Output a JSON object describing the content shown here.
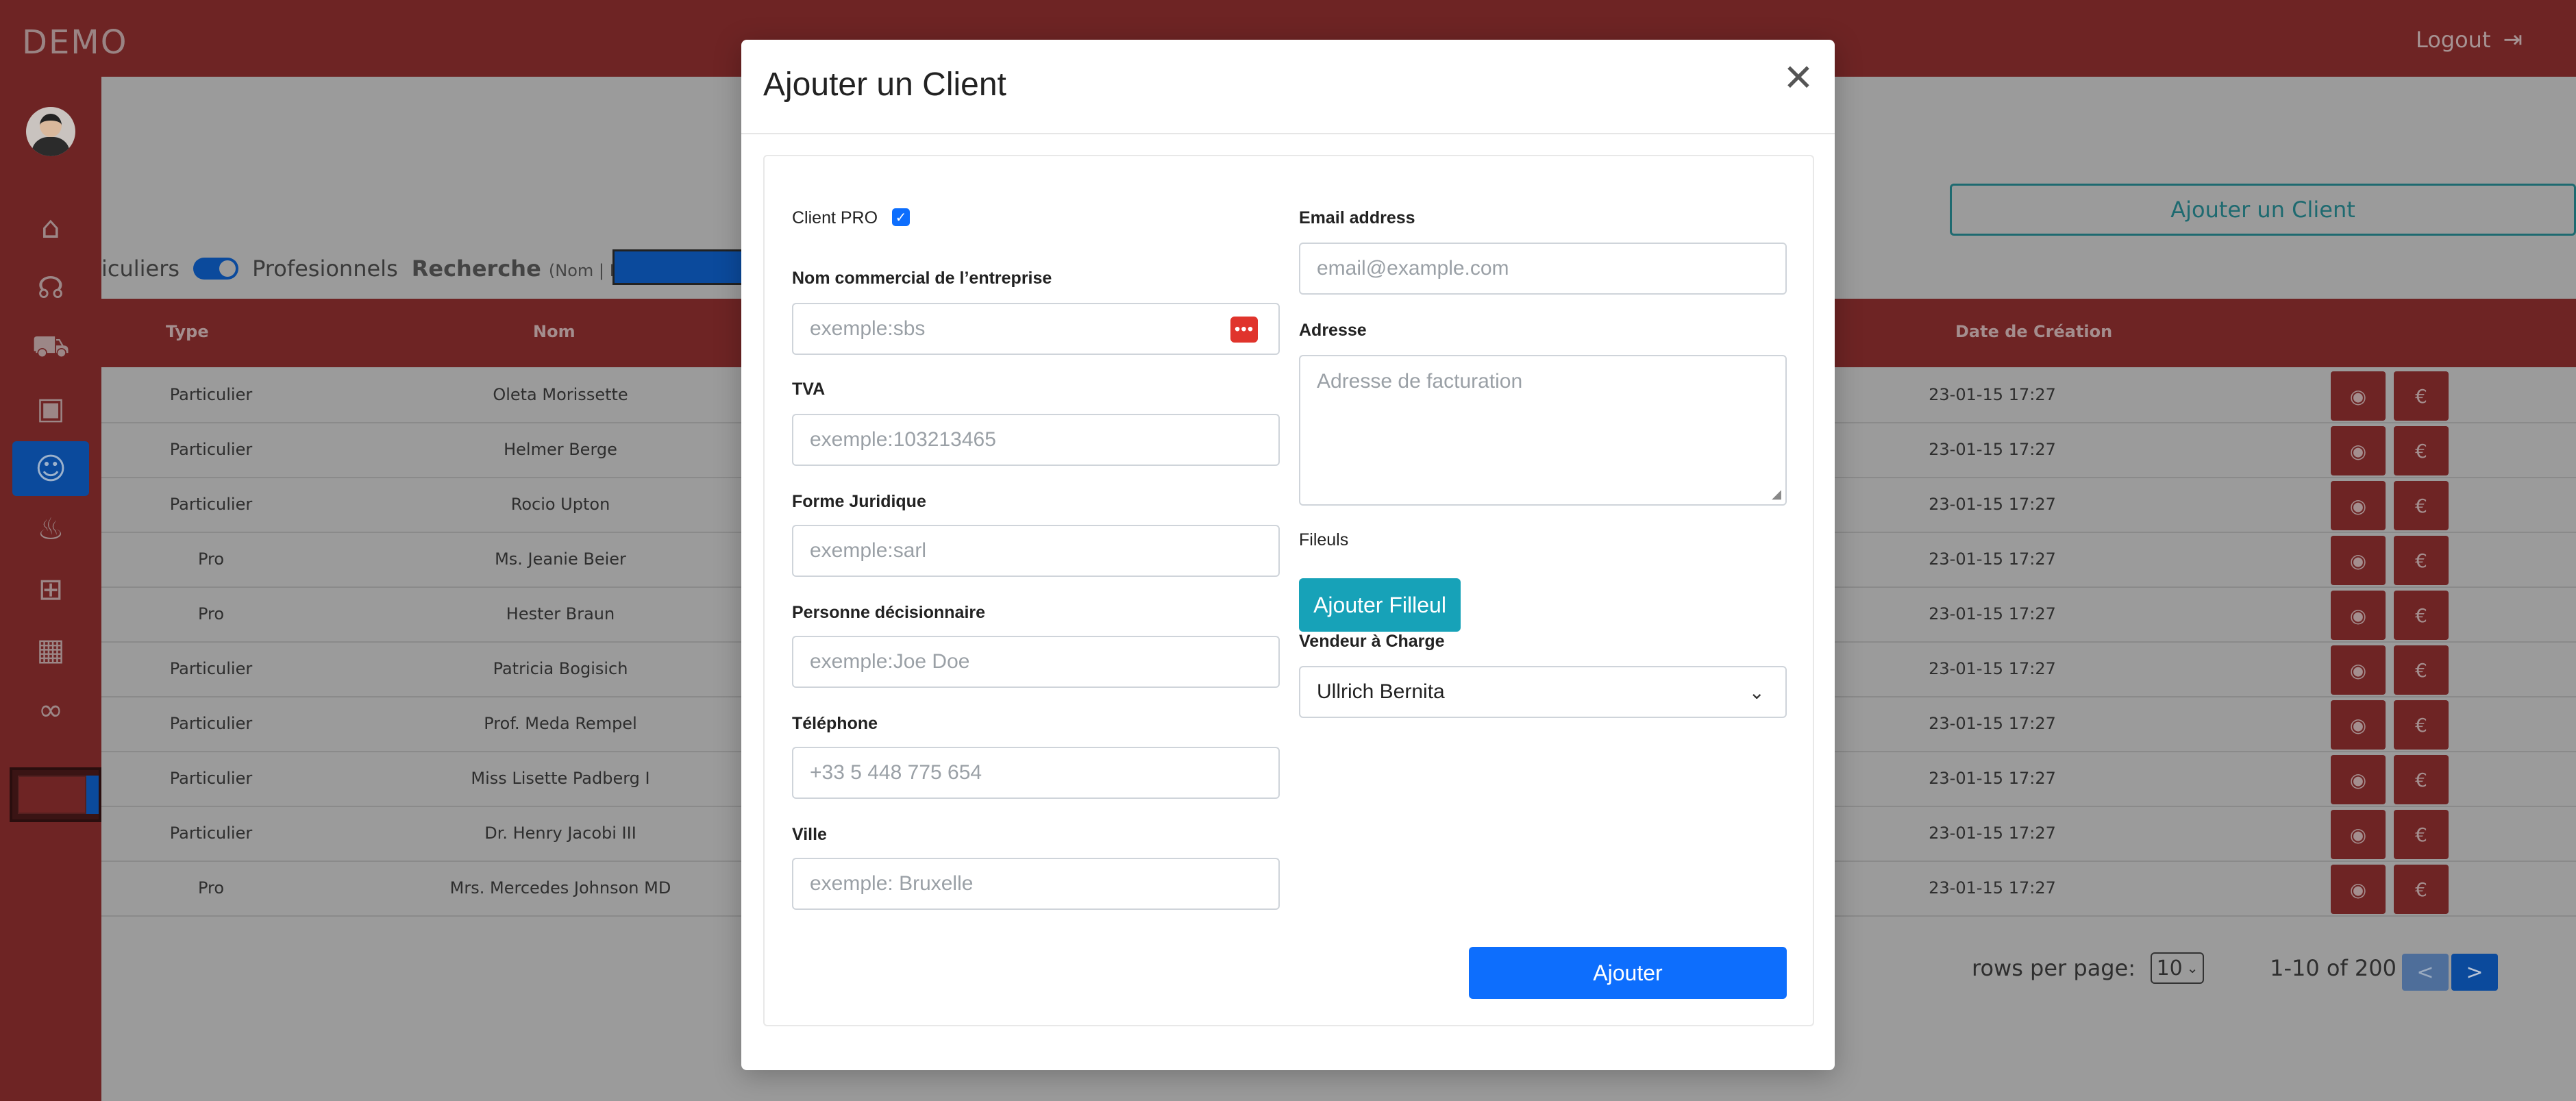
{
  "app": {
    "brand": "DEMO",
    "logout": "Logout"
  },
  "sidebar": {
    "items": [
      {
        "icon": "home-icon",
        "glyph": "⌂"
      },
      {
        "icon": "headset-icon",
        "glyph": "☊"
      },
      {
        "icon": "cart-icon",
        "glyph": "⛟"
      },
      {
        "icon": "ticket-icon",
        "glyph": "▣"
      },
      {
        "icon": "contacts-icon",
        "glyph": "☺",
        "active": true
      },
      {
        "icon": "hand-coins-icon",
        "glyph": "♨"
      },
      {
        "icon": "boxes-icon",
        "glyph": "⊞"
      },
      {
        "icon": "building-icon",
        "glyph": "▦"
      },
      {
        "icon": "handshake-icon",
        "glyph": "∞"
      }
    ]
  },
  "page": {
    "add_client_button": "Ajouter un Client",
    "filter_partial": "iculiers",
    "filter_pro": "Profesionnels",
    "search_label": "Recherche",
    "search_sub": "(Nom | Email)",
    "search_colon": ":"
  },
  "table": {
    "headers": {
      "type": "Type",
      "name": "Nom",
      "date": "Date de Création"
    },
    "rows": [
      {
        "type": "Particulier",
        "name": "Oleta Morissette",
        "date": "23-01-15 17:27"
      },
      {
        "type": "Particulier",
        "name": "Helmer Berge",
        "date": "23-01-15 17:27"
      },
      {
        "type": "Particulier",
        "name": "Rocio Upton",
        "date": "23-01-15 17:27"
      },
      {
        "type": "Pro",
        "name": "Ms. Jeanie Beier",
        "date": "23-01-15 17:27"
      },
      {
        "type": "Pro",
        "name": "Hester Braun",
        "date": "23-01-15 17:27"
      },
      {
        "type": "Particulier",
        "name": "Patricia Bogisich",
        "date": "23-01-15 17:27"
      },
      {
        "type": "Particulier",
        "name": "Prof. Meda Rempel",
        "date": "23-01-15 17:27"
      },
      {
        "type": "Particulier",
        "name": "Miss Lisette Padberg I",
        "date": "23-01-15 17:27"
      },
      {
        "type": "Particulier",
        "name": "Dr. Henry Jacobi III",
        "date": "23-01-15 17:27"
      },
      {
        "type": "Pro",
        "name": "Mrs. Mercedes Johnson MD",
        "date": "23-01-15 17:27"
      }
    ]
  },
  "pagination": {
    "rows_label": "rows per page:",
    "rows_value": "10",
    "range": "1-10 of 200",
    "prev": "<",
    "next": ">"
  },
  "modal": {
    "title": "Ajouter un Client",
    "close": "✕",
    "client_pro_label": "Client PRO",
    "client_pro_checked": true,
    "company": {
      "label": "Nom commercial de l’entreprise",
      "placeholder": "exemple:sbs"
    },
    "tva": {
      "label": "TVA",
      "placeholder": "exemple:103213465"
    },
    "forme": {
      "label": "Forme Juridique",
      "placeholder": "exemple:sarl"
    },
    "decision": {
      "label": "Personne décisionnaire",
      "placeholder": "exemple:Joe Doe"
    },
    "phone": {
      "label": "Téléphone",
      "placeholder": "+33 5 448 775 654"
    },
    "city": {
      "label": "Ville",
      "placeholder": "exemple: Bruxelle"
    },
    "email": {
      "label": "Email address",
      "placeholder": "email@example.com"
    },
    "address": {
      "label": "Adresse",
      "placeholder": "Adresse de facturation"
    },
    "fileuls_label": "Fileuls",
    "add_fileul_button": "Ajouter Filleul",
    "seller": {
      "label": "Vendeur à Charge",
      "value": "Ullrich Bernita"
    },
    "submit": "Ajouter"
  },
  "colors": {
    "primary": "#0d6efd",
    "teal": "#17a2b8",
    "brand_dark": "#6e2424",
    "danger": "#e0342c"
  }
}
